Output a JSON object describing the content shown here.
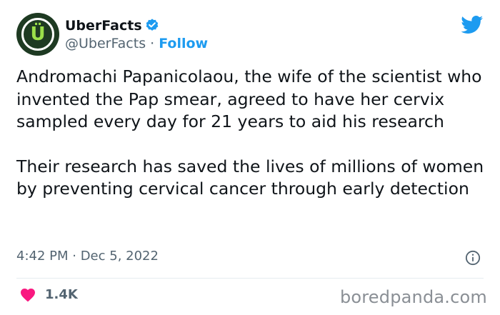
{
  "author": {
    "display_name": "UberFacts",
    "handle": "@UberFacts",
    "separator": " · ",
    "follow_label": "Follow",
    "avatar_letter": "Ü"
  },
  "tweet": {
    "paragraphs": [
      "Andromachi Papanicolaou, the wife of the scientist who invented the Pap smear, agreed to have her cervix sampled every day for 21 years to aid his research",
      "Their research has saved the lives of millions of women by preventing cervical cancer through early detection"
    ],
    "timestamp": "4:42 PM · Dec 5, 2022",
    "like_count": "1.4K"
  },
  "watermark": "boredpanda.com",
  "colors": {
    "accent": "#1d9bf0",
    "heart": "#f91880",
    "text": "#0f1419",
    "secondary": "#536471",
    "avatar_bg": "#1e3a22",
    "avatar_letter": "#9be04a"
  },
  "icons": {
    "platform": "twitter-bird-icon",
    "verified": "verified-badge-icon",
    "info": "info-icon",
    "like": "heart-icon"
  }
}
